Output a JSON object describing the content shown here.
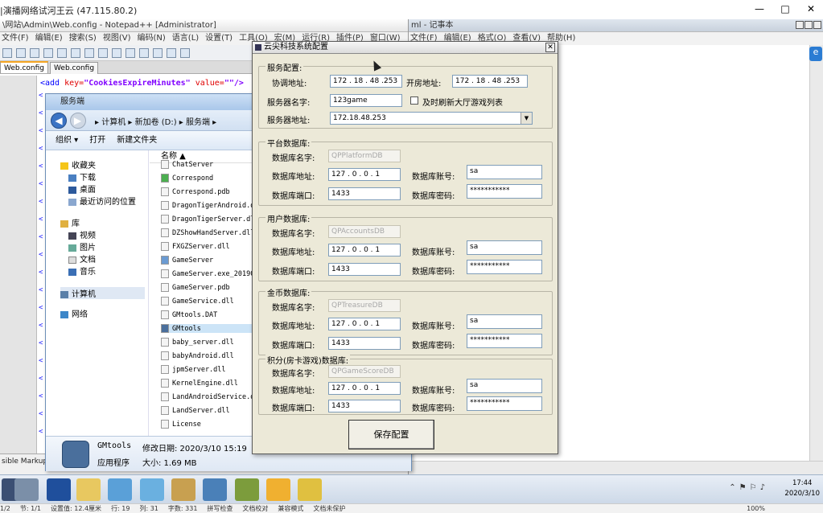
{
  "rdp": {
    "title": "|演播网络试河王云 (47.115.80.2)",
    "min": "—",
    "max": "□",
    "close": "✕"
  },
  "notepadpp": {
    "title": "\\网站\\Admin\\Web.config - Notepad++ [Administrator]",
    "menu": [
      "文件(F)",
      "编辑(E)",
      "搜索(S)",
      "视图(V)",
      "编码(N)",
      "语言(L)",
      "设置(T)",
      "工具(O)",
      "宏(M)",
      "运行(R)",
      "插件(P)",
      "窗口(W)",
      "?"
    ],
    "tabs": [
      "Web.config",
      "Web.config"
    ],
    "code_line": {
      "tag": "<add",
      "key_attr": "key=",
      "key_val": "\"CookiesExpireMinutes\"",
      "value_attr": "value=",
      "value_val": "\"\"/>"
    },
    "status_left": "sible Markup"
  },
  "notepad": {
    "title": "ml - 记事本",
    "menu": [
      "文件(F)",
      "编辑(E)",
      "格式(O)",
      "查看(V)",
      "帮助(H)"
    ]
  },
  "explorer": {
    "title": "服务端",
    "breadcrumb": "▸ 计算机 ▸ 新加卷 (D:) ▸ 服务端 ▸",
    "commands": [
      "组织 ▾",
      "打开",
      "新建文件夹"
    ],
    "nav": {
      "favorites": "收藏夹",
      "downloads": "下载",
      "desktop": "桌面",
      "recent": "最近访问的位置",
      "libraries": "库",
      "videos": "视频",
      "pictures": "图片",
      "documents": "文档",
      "music": "音乐",
      "computer": "计算机",
      "network": "网络"
    },
    "column_name": "名称 ▲",
    "files": [
      "ChatServer",
      "Correspond",
      "Correspond.pdb",
      "DragonTigerAndroid.dll",
      "DragonTigerServer.dll",
      "DZShowHandServer.dll",
      "FXGZServer.dll",
      "GameServer",
      "GameServer.exe_201907",
      "GameServer.pdb",
      "GameService.dll",
      "GMtools.DAT",
      "GMtools",
      "baby_server.dll",
      "babyAndroid.dll",
      "jpmServer.dll",
      "KernelEngine.dll",
      "LandAndroidService.dll",
      "LandServer.dll",
      "License"
    ],
    "details": {
      "name": "GMtools",
      "modified": "修改日期: 2020/3/10 15:19",
      "type": "应用程序",
      "size": "大小: 1.69 MB"
    }
  },
  "config": {
    "title": "云尖科技系统配置",
    "server": {
      "group": "服务配置:",
      "coord_label": "协调地址:",
      "coord_value": "172 . 18 . 48 .253",
      "room_label": "开房地址:",
      "room_value": "172 . 18 . 48 .253",
      "name_label": "服务器名字:",
      "name_value": "123game",
      "refresh_label": "及时刷新大厅游戏列表",
      "addr_label": "服务器地址:",
      "addr_value": "172.18.48.253"
    },
    "db_groups": [
      {
        "group": "平台数据库:",
        "name_label": "数据库名字:",
        "name_value": "QPPlatformDB",
        "addr_label": "数据库地址:",
        "addr_value": "127 . 0 . 0 . 1",
        "port_label": "数据库端口:",
        "port_value": "1433",
        "acct_label": "数据库账号:",
        "acct_value": "sa",
        "pwd_label": "数据库密码:",
        "pwd_value": "***********"
      },
      {
        "group": "用户数据库:",
        "name_label": "数据库名字:",
        "name_value": "QPAccountsDB",
        "addr_label": "数据库地址:",
        "addr_value": "127 . 0 . 0 . 1",
        "port_label": "数据库端口:",
        "port_value": "1433",
        "acct_label": "数据库账号:",
        "acct_value": "sa",
        "pwd_label": "数据库密码:",
        "pwd_value": "***********"
      },
      {
        "group": "金币数据库:",
        "name_label": "数据库名字:",
        "name_value": "QPTreasureDB",
        "addr_label": "数据库地址:",
        "addr_value": "127 . 0 . 0 . 1",
        "port_label": "数据库端口:",
        "port_value": "1433",
        "acct_label": "数据库账号:",
        "acct_value": "sa",
        "pwd_label": "数据库密码:",
        "pwd_value": "***********"
      },
      {
        "group": "积分(房卡游戏)数据库:",
        "name_label": "数据库名字:",
        "name_value": "QPGameScoreDB",
        "addr_label": "数据库地址:",
        "addr_value": "127 . 0 . 0 . 1",
        "port_label": "数据库端口:",
        "port_value": "1433",
        "acct_label": "数据库账号:",
        "acct_value": "sa",
        "pwd_label": "数据库密码:",
        "pwd_value": "***********"
      }
    ],
    "save": "保存配置"
  },
  "taskbar": {
    "time": "17:44",
    "date": "2020/3/10"
  },
  "wps_status": [
    "1/2",
    "节: 1/1",
    "设置值: 12.4厘米",
    "行: 19",
    "列: 31",
    "字数: 331",
    "拼写检查",
    "文档校对",
    "兼容模式",
    "文档未保护",
    "100%"
  ],
  "colors": {
    "dialog_bg": "#ece9d8",
    "accent": "#3a73c4",
    "code_keyword": "#0000ff",
    "code_attr": "#e00000",
    "code_string": "#8000ff"
  }
}
